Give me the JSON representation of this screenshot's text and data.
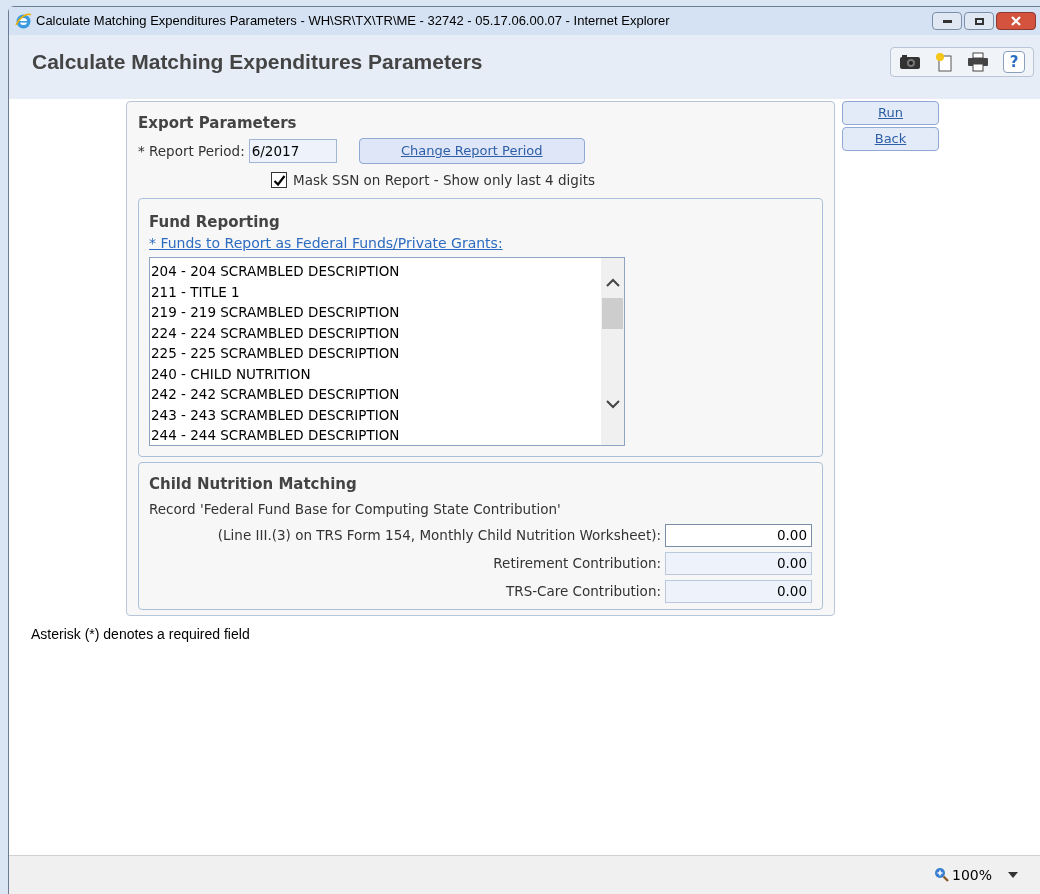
{
  "window": {
    "title": "Calculate Matching Expenditures Parameters - WH\\SR\\TX\\TR\\ME - 32742 - 05.17.06.00.07 - Internet Explorer"
  },
  "header": {
    "title": "Calculate Matching Expenditures Parameters"
  },
  "toolbar": {
    "help": "?"
  },
  "actions": [
    "Run",
    "Back"
  ],
  "export_parameters": {
    "heading": "Export Parameters",
    "report_period": {
      "label": "* Report Period:",
      "value": "6/2017"
    },
    "change_button": "Change Report Period",
    "mask_ssn": {
      "label": "Mask SSN on Report - Show only last 4 digits",
      "checked": true
    }
  },
  "fund_reporting": {
    "heading": "Fund Reporting",
    "link": "* Funds to Report as Federal Funds/Private Grants:",
    "funds": [
      "204 - 204 SCRAMBLED DESCRIPTION",
      "211 - TITLE 1",
      "219 - 219 SCRAMBLED DESCRIPTION",
      "224 - 224 SCRAMBLED DESCRIPTION",
      "225 - 225 SCRAMBLED DESCRIPTION",
      "240 - CHILD NUTRITION",
      "242 - 242 SCRAMBLED DESCRIPTION",
      "243 - 243 SCRAMBLED DESCRIPTION",
      "244 - 244 SCRAMBLED DESCRIPTION"
    ]
  },
  "child_nutrition": {
    "heading": "Child Nutrition Matching",
    "note": "Record 'Federal Fund Base for Computing State Contribution'",
    "fields": [
      {
        "label": "(Line III.(3) on TRS Form 154, Monthly Child Nutrition Worksheet):",
        "value": "0.00",
        "kind": "editable"
      },
      {
        "label": "Retirement Contribution:",
        "value": "0.00",
        "kind": "readonly"
      },
      {
        "label": "TRS-Care Contribution:",
        "value": "0.00",
        "kind": "readonly"
      }
    ]
  },
  "footnote": "Asterisk (*) denotes a required field",
  "status_bar": {
    "zoom": "100%"
  }
}
